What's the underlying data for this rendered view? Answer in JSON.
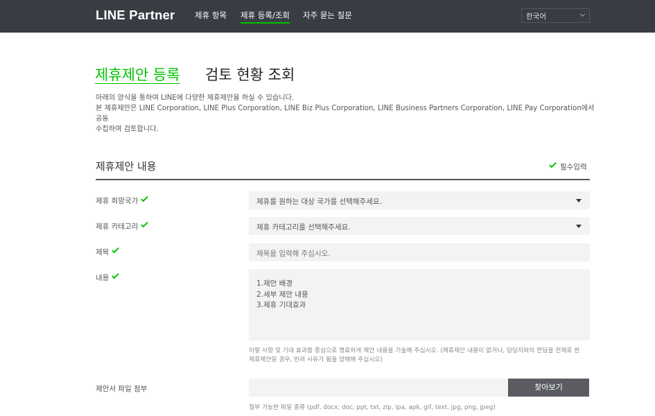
{
  "header": {
    "logo": "LINE Partner",
    "nav": [
      {
        "label": "제휴 항목",
        "active": false
      },
      {
        "label": "제휴 등록/조회",
        "active": true
      },
      {
        "label": "자주 묻는 질문",
        "active": false
      }
    ],
    "language": "한국어",
    "accent_color": "#00c300",
    "bg_color": "#3a3c44"
  },
  "page_tabs": {
    "active": "제휴제안 등록",
    "inactive": "검토 현황 조회"
  },
  "description": {
    "line1": "아래의 양식을 통하여 LINE에 다양한 제휴제안을 하실 수 있습니다.",
    "line2": "본 제휴제안은 LINE Corporation, LINE Plus Corporation, LINE Biz Plus Corporation, LINE Business Partners Corporation, LINE Pay Corporation에서 공동",
    "line3": "수집하여 검토합니다."
  },
  "section": {
    "title": "제휴제안 내용",
    "required_note": "필수입력"
  },
  "form": {
    "country": {
      "label": "제휴 희망국가",
      "placeholder": "제휴를 원하는 대상 국가를 선택해주세요."
    },
    "category": {
      "label": "제휴 카테고리",
      "placeholder": "제휴 카테고리를 선택해주세요."
    },
    "subject": {
      "label": "제목",
      "placeholder": "제목을 입력해 주십시오."
    },
    "content": {
      "label": "내용",
      "line1": "1.제안 배경",
      "line2": "2.세부 제안 내용",
      "line3": "3.제휴 기대효과",
      "help_line1": "이렇 사항 및 기대 효과를 중심으로 명료하게 제안 내용을 기술해 주십시오. (제휴제안 내용이 없거나, 담당자와의 면담을 전제로 한",
      "help_line2": "제휴제안일 경우, 반려 사유가 됨을 양해해 주십시오)"
    },
    "attachment": {
      "label": "제안서 파일 첨부",
      "button": "찾아보기",
      "help": "첨부 가능한 파일 종류 (pdf, docx, doc, ppt, txt, zip, ipa, apk, gif, text, jpg, png, jpeg)"
    }
  }
}
